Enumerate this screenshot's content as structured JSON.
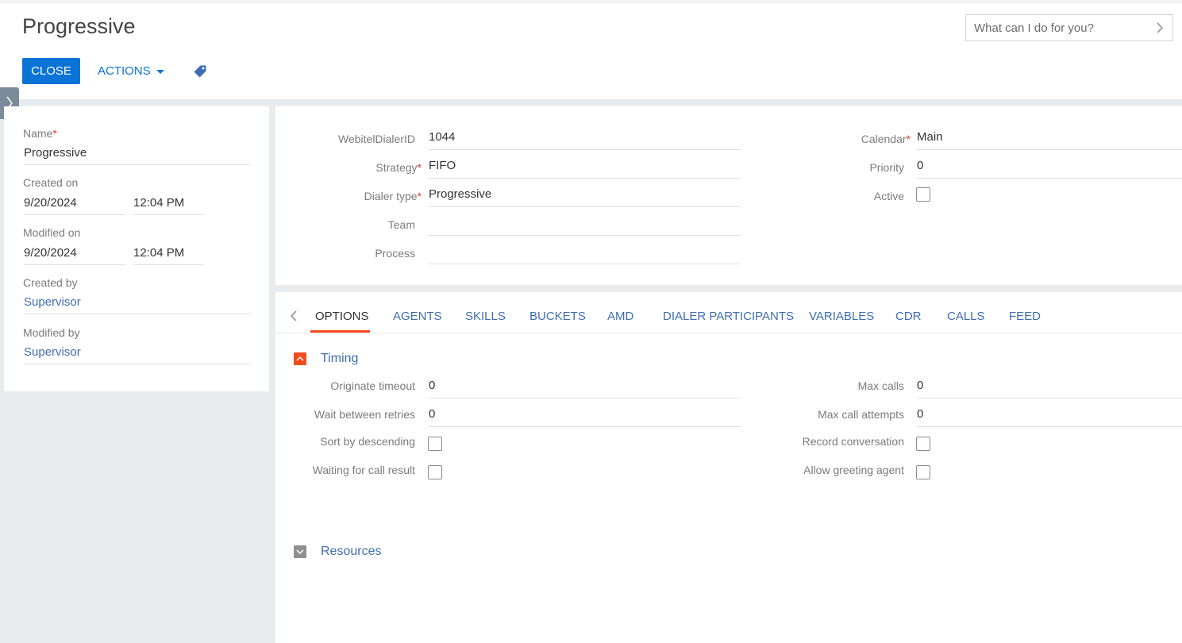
{
  "header": {
    "title": "Progressive",
    "close_label": "CLOSE",
    "actions_label": "ACTIONS",
    "search_placeholder": "What can I do for you?"
  },
  "left_panel": {
    "name_label": "Name",
    "name_value": "Progressive",
    "created_on_label": "Created on",
    "created_on_date": "9/20/2024",
    "created_on_time": "12:04 PM",
    "modified_on_label": "Modified on",
    "modified_on_date": "9/20/2024",
    "modified_on_time": "12:04 PM",
    "created_by_label": "Created by",
    "created_by_value": "Supervisor",
    "modified_by_label": "Modified by",
    "modified_by_value": "Supervisor"
  },
  "main_fields": {
    "dialer_id_label": "WebitelDialerID",
    "dialer_id_value": "1044",
    "strategy_label": "Strategy",
    "strategy_value": "FIFO",
    "dialer_type_label": "Dialer type",
    "dialer_type_value": "Progressive",
    "team_label": "Team",
    "team_value": "",
    "process_label": "Process",
    "process_value": "",
    "calendar_label": "Calendar",
    "calendar_value": "Main",
    "priority_label": "Priority",
    "priority_value": "0",
    "active_label": "Active"
  },
  "tabs": {
    "options": "OPTIONS",
    "agents": "AGENTS",
    "skills": "SKILLS",
    "buckets": "BUCKETS",
    "amd": "AMD",
    "dialer_participants": "DIALER PARTICIPANTS",
    "variables": "VARIABLES",
    "cdr": "CDR",
    "calls": "CALLS",
    "feed": "FEED"
  },
  "timing": {
    "title": "Timing",
    "originate_timeout_label": "Originate timeout",
    "originate_timeout_value": "0",
    "wait_between_retries_label": "Wait between retries",
    "wait_between_retries_value": "0",
    "sort_by_descending_label": "Sort by descending",
    "waiting_for_call_result_label": "Waiting for call result",
    "max_calls_label": "Max calls",
    "max_calls_value": "0",
    "max_call_attempts_label": "Max call attempts",
    "max_call_attempts_value": "0",
    "record_conversation_label": "Record conversation",
    "allow_greeting_agent_label": "Allow greeting agent"
  },
  "resources": {
    "title": "Resources"
  },
  "colors": {
    "primary": "#0b73d6",
    "link": "#3f6db3",
    "accent": "#f44c1c",
    "required": "#e53935"
  }
}
